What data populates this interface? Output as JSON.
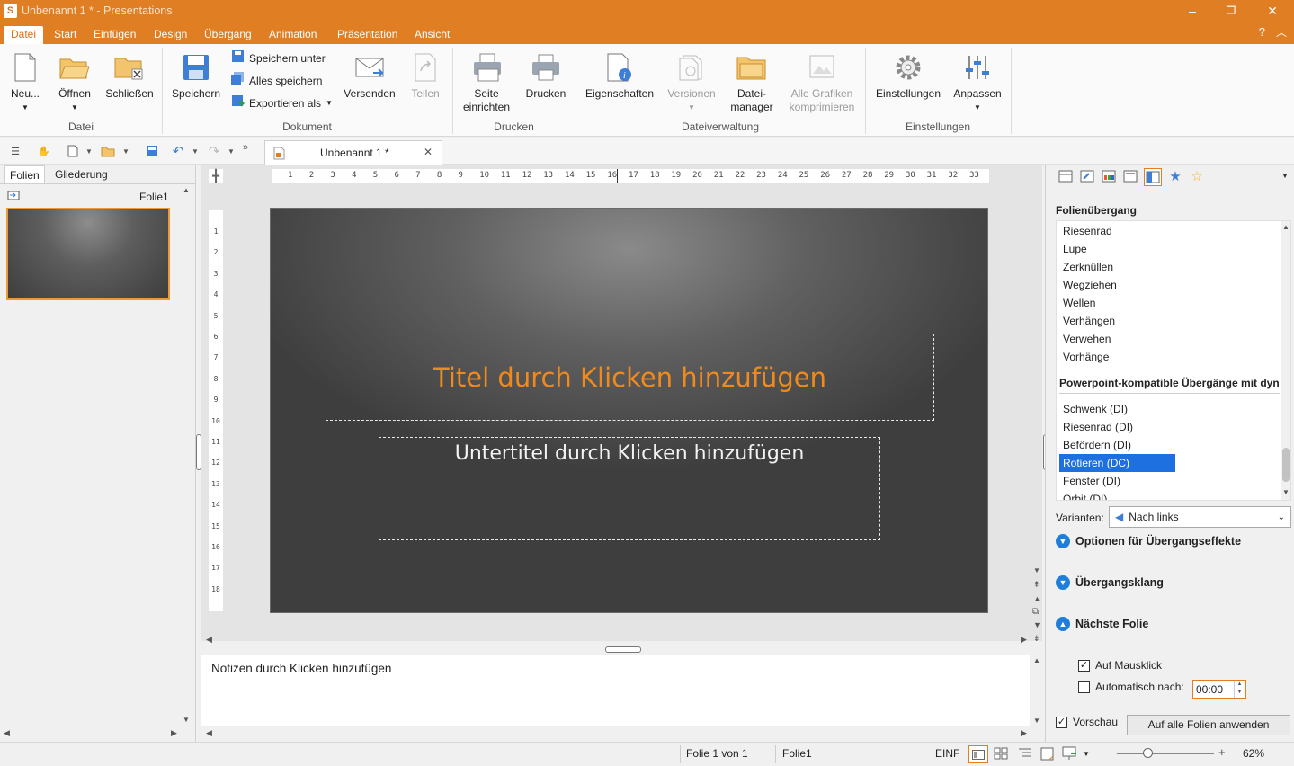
{
  "app": {
    "title": "Unbenannt 1 * - Presentations",
    "icon_letter": "S"
  },
  "window_controls": {
    "minimize": "–",
    "restore": "❐",
    "close": "✕"
  },
  "menu_tabs": [
    "Datei",
    "Start",
    "Einfügen",
    "Design",
    "Übergang",
    "Animation",
    "Präsentation",
    "Ansicht"
  ],
  "help": "?",
  "ribbon": {
    "groups": {
      "datei": "Datei",
      "dokument": "Dokument",
      "drucken": "Drucken",
      "dateiverwaltung": "Dateiverwaltung",
      "einstellungen": "Einstellungen"
    },
    "buttons": {
      "neu": "Neu...",
      "oeffnen": "Öffnen",
      "schliessen": "Schließen",
      "speichern": "Speichern",
      "speichern_unter": "Speichern unter",
      "alles_speichern": "Alles speichern",
      "exportieren_als": "Exportieren als",
      "versenden": "Versenden",
      "teilen": "Teilen",
      "seite_einrichten_1": "Seite",
      "seite_einrichten_2": "einrichten",
      "drucken": "Drucken",
      "eigenschaften": "Eigenschaften",
      "versionen": "Versionen",
      "dateimanager_1": "Datei-",
      "dateimanager_2": "manager",
      "grafiken_1": "Alle Grafiken",
      "grafiken_2": "komprimieren",
      "einstellungen": "Einstellungen",
      "anpassen": "Anpassen"
    }
  },
  "document_tab": {
    "name": "Unbenannt 1 *"
  },
  "left_panel": {
    "tabs": [
      "Folien",
      "Gliederung"
    ],
    "slide_label": "Folie1"
  },
  "ruler": {
    "horizontal": [
      "1",
      "2",
      "3",
      "4",
      "5",
      "6",
      "7",
      "8",
      "9",
      "10",
      "11",
      "12",
      "13",
      "14",
      "15",
      "16",
      "17",
      "18",
      "19",
      "20",
      "21",
      "22",
      "23",
      "24",
      "25",
      "26",
      "27",
      "28",
      "29",
      "30",
      "31",
      "32",
      "33"
    ],
    "vertical": [
      "1",
      "2",
      "3",
      "4",
      "5",
      "6",
      "7",
      "8",
      "9",
      "10",
      "11",
      "12",
      "13",
      "14",
      "15",
      "16",
      "17",
      "18"
    ]
  },
  "slide": {
    "title_placeholder": "Titel durch Klicken hinzufügen",
    "subtitle_placeholder": "Untertitel durch Klicken hinzufügen",
    "title_color": "#f08a1c"
  },
  "notes": {
    "placeholder": "Notizen durch Klicken hinzufügen"
  },
  "right_panel": {
    "heading": "Folienübergang",
    "transitions": [
      "Riesenrad",
      "Lupe",
      "Zerknüllen",
      "Wegziehen",
      "Wellen",
      "Verhängen",
      "Verwehen",
      "Vorhänge"
    ],
    "group_heading": "Powerpoint-kompatible Übergänge mit dyn",
    "dynamic_transitions": [
      "Schwenk (DI)",
      "Riesenrad (DI)",
      "Befördern (DI)",
      "Rotieren (DC)",
      "Fenster (DI)",
      "Orbit (DI)"
    ],
    "selected": "Rotieren (DC)",
    "variants_label": "Varianten:",
    "variants_value": "Nach links",
    "sections": {
      "effects": "Optionen für Übergangseffekte",
      "sound": "Übergangsklang",
      "next": "Nächste Folie"
    },
    "on_click_label": "Auf Mausklick",
    "on_click_checked": true,
    "auto_label": "Automatisch nach:",
    "auto_checked": false,
    "auto_value": "00:00",
    "preview_label": "Vorschau",
    "preview_checked": true,
    "apply_all": "Auf alle Folien anwenden"
  },
  "status": {
    "slide_of": "Folie 1 von 1",
    "slide_name": "Folie1",
    "mode": "EINF",
    "zoom": "62%",
    "zoom_level": 0.62
  },
  "accent_color": "#e07e23",
  "selection_color": "#1e6fe0"
}
